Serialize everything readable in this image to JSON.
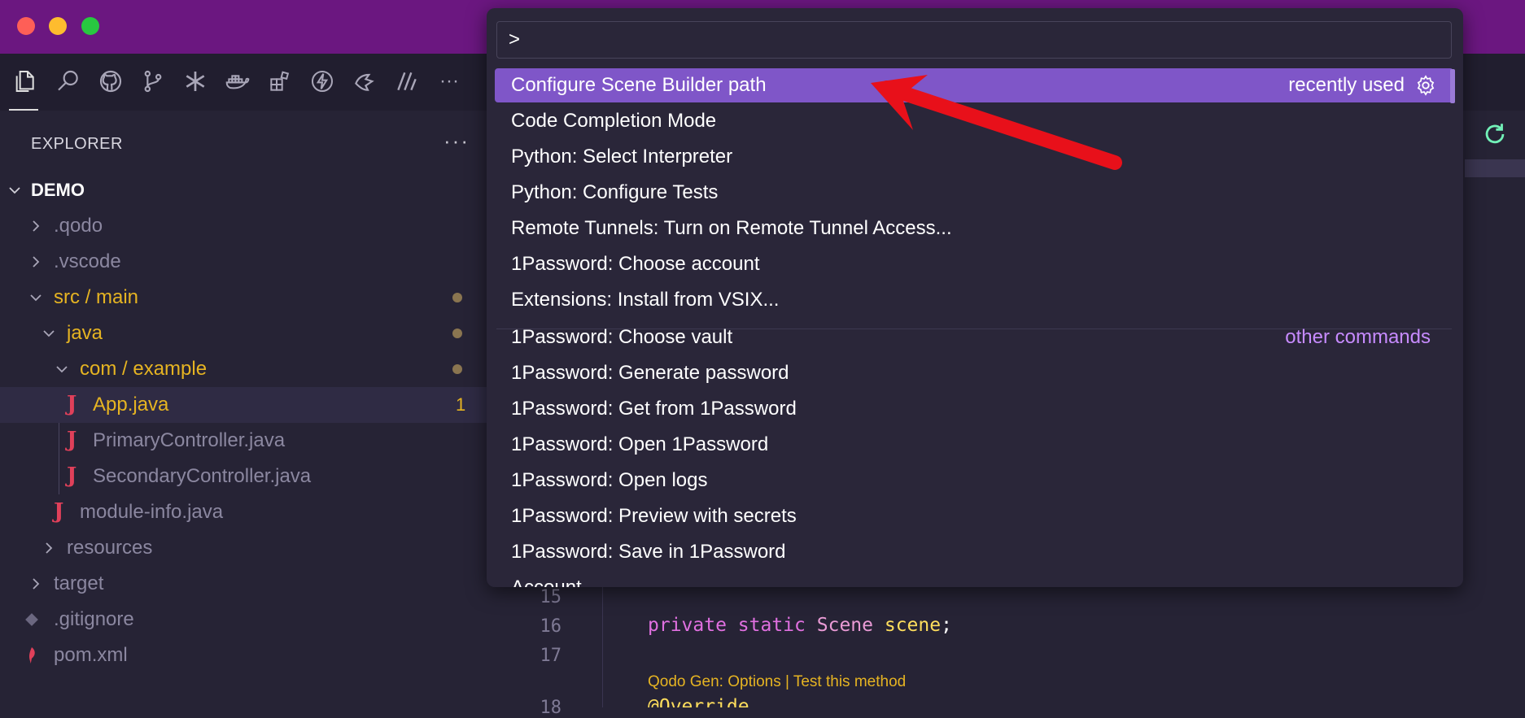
{
  "sidebar": {
    "title": "EXPLORER",
    "more": "···",
    "tree": [
      {
        "label": ".qodo",
        "kind": "folder",
        "color": "#8b87a0"
      },
      {
        "label": ".vscode",
        "kind": "folder",
        "color": "#8b87a0"
      },
      {
        "label": "src / main",
        "kind": "folder-open",
        "color": "#e6b422",
        "modified": true
      },
      {
        "label": "java",
        "kind": "folder-open",
        "color": "#e6b422",
        "modified": true
      },
      {
        "label": "com / example",
        "kind": "folder-open",
        "color": "#e6b422",
        "modified": true
      },
      {
        "label": "App.java",
        "kind": "java",
        "color": "#e6b422",
        "badge": "1",
        "selected": true
      },
      {
        "label": "PrimaryController.java",
        "kind": "java",
        "color": "#8b87a0"
      },
      {
        "label": "SecondaryController.java",
        "kind": "java",
        "color": "#8b87a0"
      },
      {
        "label": "module-info.java",
        "kind": "java",
        "color": "#8b87a0"
      },
      {
        "label": "resources",
        "kind": "folder",
        "color": "#8b87a0"
      },
      {
        "label": "target",
        "kind": "folder",
        "color": "#8b87a0"
      },
      {
        "label": ".gitignore",
        "kind": "git",
        "color": "#8b87a0"
      },
      {
        "label": "pom.xml",
        "kind": "maven",
        "color": "#8b87a0"
      }
    ],
    "root": "DEMO"
  },
  "palette": {
    "input_value": ">",
    "items": [
      {
        "label": "Configure Scene Builder path",
        "right": "recently used",
        "active": true
      },
      {
        "label": "Code Completion Mode"
      },
      {
        "label": "Python: Select Interpreter"
      },
      {
        "label": "Python: Configure Tests"
      },
      {
        "label": "Remote Tunnels: Turn on Remote Tunnel Access..."
      },
      {
        "label": "1Password: Choose account"
      },
      {
        "label": "Extensions: Install from VSIX..."
      },
      {
        "label": "1Password: Choose vault",
        "right": "other commands"
      },
      {
        "label": "1Password: Generate password"
      },
      {
        "label": "1Password: Get from 1Password"
      },
      {
        "label": "1Password: Open 1Password"
      },
      {
        "label": "1Password: Open logs"
      },
      {
        "label": "1Password: Preview with secrets"
      },
      {
        "label": "1Password: Save in 1Password"
      },
      {
        "label": "Account"
      }
    ]
  },
  "editor": {
    "lines": [
      {
        "num": "15"
      },
      {
        "num": "16"
      },
      {
        "num": "17"
      },
      {
        "num": "18"
      }
    ],
    "code": {
      "kw1": "private",
      "kw2": "static",
      "type": "Scene",
      "var": "scene",
      "end": ";",
      "annotation": "@Override"
    },
    "codelens": "Qodo Gen: Options | Test this method"
  },
  "colors": {
    "titlebar": "#6b1780",
    "accent": "#7f56c8",
    "arrow": "#e8101a"
  }
}
